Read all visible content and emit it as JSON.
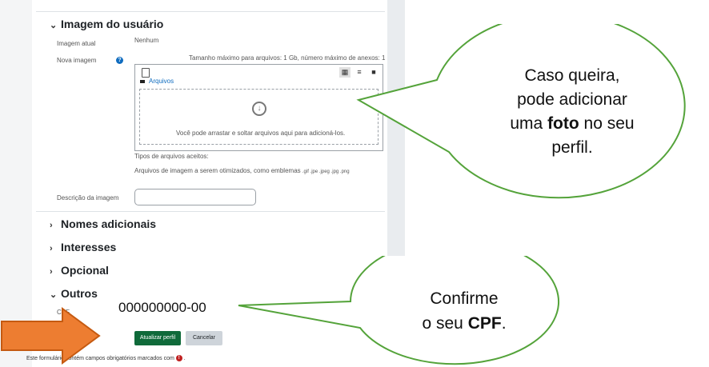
{
  "sections": {
    "user_image": {
      "title": "Imagem do usuário",
      "current_label": "Imagem atual",
      "current_value": "Nenhum",
      "new_label": "Nova imagem",
      "size_info": "Tamanho máximo para arquivos: 1 Gb, número máximo de anexos: 1",
      "folder_label": "Arquivos",
      "drop_text": "Você pode arrastar e soltar arquivos aqui para adicioná-los.",
      "accepted_title": "Tipos de arquivos aceitos:",
      "accepted_desc": "Arquivos de imagem a serem otimizados, como emblemas",
      "accepted_exts": ".gif .jpe .jpeg .jpg .png",
      "desc_label": "Descrição da imagem"
    },
    "nomes": "Nomes adicionais",
    "interesses": "Interesses",
    "opcional": "Opcional",
    "outros": "Outros",
    "cpf_label": "CPF",
    "cpf_value": "000000000-00"
  },
  "buttons": {
    "update": "Atualizar perfil",
    "cancel": "Cancelar"
  },
  "footer": {
    "required_note": "Este formulário contém campos obrigatórios marcados com"
  },
  "bubbles": {
    "photo": {
      "line1": "Caso queira,",
      "line2": "pode adicionar",
      "line3_pre": "uma ",
      "line3_bold": "foto",
      "line3_post": " no seu",
      "line4": "perfil."
    },
    "cpf": {
      "line1": "Confirme",
      "line2_pre": "o seu ",
      "line2_bold": "CPF",
      "line2_post": "."
    }
  },
  "colors": {
    "primary": "#0f6a3a",
    "link": "#0f6cbf",
    "required": "#c02020",
    "arrow": "#ed7d31",
    "bubble_stroke": "#54a33a",
    "bubble_fill": "#ffffff"
  }
}
